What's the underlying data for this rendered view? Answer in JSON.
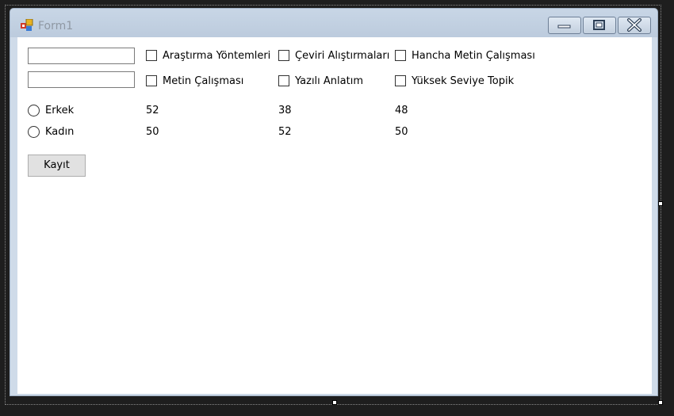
{
  "window": {
    "title": "Form1"
  },
  "textboxes": [
    {
      "value": "",
      "placeholder": ""
    },
    {
      "value": "",
      "placeholder": ""
    }
  ],
  "checkboxes": [
    {
      "label": "Araştırma Yöntemleri",
      "checked": false
    },
    {
      "label": "Çeviri Alıştırmaları",
      "checked": false
    },
    {
      "label": "Hancha Metin Çalışması",
      "checked": false
    },
    {
      "label": "Metin Çalışması",
      "checked": false
    },
    {
      "label": "Yazılı Anlatım",
      "checked": false
    },
    {
      "label": "Yüksek Seviye Topik",
      "checked": false
    }
  ],
  "radios": [
    {
      "label": "Erkek",
      "checked": false
    },
    {
      "label": "Kadın",
      "checked": false
    }
  ],
  "counts": {
    "row1": [
      "52",
      "38",
      "48"
    ],
    "row2": [
      "50",
      "52",
      "50"
    ]
  },
  "save_button": "Kayıt"
}
